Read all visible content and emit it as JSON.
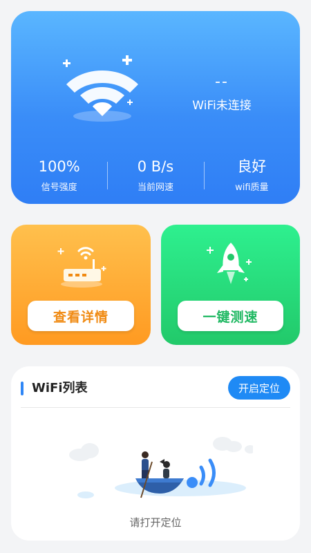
{
  "status": {
    "ssid": "--",
    "connection_text": "WiFi未连接"
  },
  "stats": [
    {
      "value": "100%",
      "label": "信号强度"
    },
    {
      "value": "0 B/s",
      "label": "当前网速"
    },
    {
      "value": "良好",
      "label": "wifi质量"
    }
  ],
  "tiles": {
    "details_label": "查看详情",
    "speedtest_label": "一键测速"
  },
  "wifi_list": {
    "title": "WiFi列表",
    "locate_button": "开启定位",
    "empty_text": "请打开定位"
  },
  "icons": {
    "wifi": "wifi-icon",
    "router": "router-icon",
    "rocket": "rocket-icon",
    "boat": "boat-illustration"
  },
  "colors": {
    "top_card": "#3a8df8",
    "orange_tile": "#ff9a21",
    "green_tile": "#22c96a",
    "accent_blue": "#1f8af5"
  }
}
